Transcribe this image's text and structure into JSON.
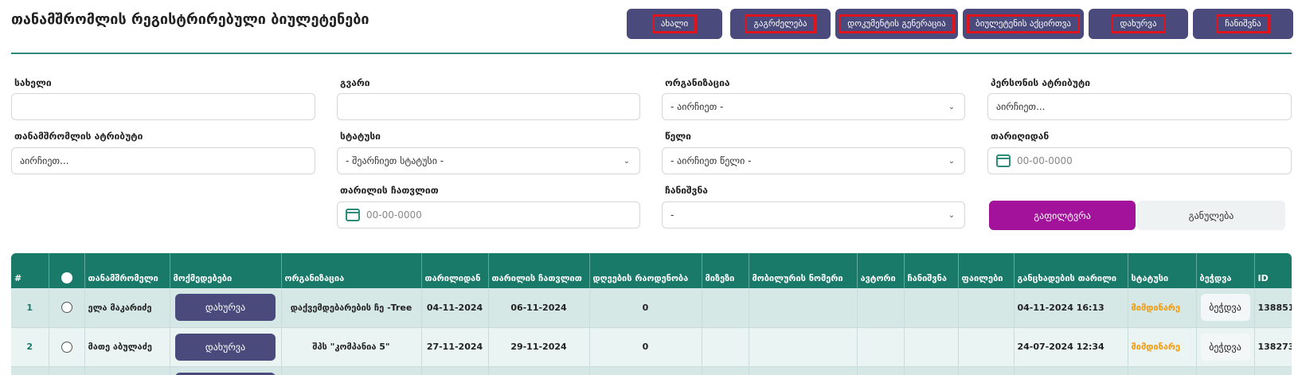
{
  "page": {
    "title": "თანამშრომლის რეგისტრირებული ბიულეტენები"
  },
  "toolbar": {
    "buttons": [
      {
        "label": "ახალი"
      },
      {
        "label": "გაგრძელება"
      },
      {
        "label": "დოკუმენტის გენერაცია"
      },
      {
        "label": "ბიულეტენის აქცირთვა"
      },
      {
        "label": "დახურვა"
      },
      {
        "label": "ჩანიშვნა"
      }
    ]
  },
  "filters": {
    "first_name": {
      "label": "სახელი",
      "value": ""
    },
    "last_name": {
      "label": "გვარი",
      "value": ""
    },
    "organization": {
      "label": "ორგანიზაცია",
      "value": "- აირჩიეთ -"
    },
    "person_attribute": {
      "label": "პერსონის ატრიბუტი",
      "value": "აირჩიეთ..."
    },
    "employee_attribute": {
      "label": "თანამშრომლის ატრიბუტი",
      "value": "აირჩიეთ..."
    },
    "status": {
      "label": "სტატუსი",
      "value": "- შეარჩიეთ სტატუსი -"
    },
    "year": {
      "label": "წელი",
      "value": "- აირჩიეთ წელი -"
    },
    "date_from": {
      "label": "თარიღიდან",
      "placeholder": "00-00-0000"
    },
    "date_to": {
      "label": "თარილის ჩათვლით",
      "placeholder": "00-00-0000"
    },
    "bookmark": {
      "label": "ჩანიშვნა",
      "value": "-"
    },
    "filter_button": "გაფილტვრა",
    "reset_button": "განულება"
  },
  "table": {
    "headers": [
      "#",
      "",
      "თანამშრომელი",
      "მოქმედებები",
      "ორგანიზაცია",
      "თარილიდან",
      "თარილის ჩათვლით",
      "დღეების რაოდენობა",
      "მიზეზი",
      "მობილურის ნომერი",
      "ავტორი",
      "ჩანიშვნა",
      "ფაილები",
      "განცხადების თარილი",
      "სტატუსი",
      "ბეჭდვა",
      "ID"
    ],
    "rows": [
      {
        "num": "1",
        "employee": "ელა მაკარიძე",
        "action": "დახურვა",
        "organization": "დაქვემდებარების ჩე -Tree",
        "date_from": "04-11-2024",
        "date_to": "06-11-2024",
        "days": "0",
        "reason": "",
        "mobile": "",
        "author": "",
        "bookmark": "",
        "files": "",
        "application_date": "04-11-2024 16:13",
        "status": "მიმდინარე",
        "print": "ბეჭდვა",
        "id": "138851"
      },
      {
        "num": "2",
        "employee": "მათე აბულაძე",
        "action": "დახურვა",
        "organization": "შპს \"კომპანია 5\"",
        "date_from": "27-11-2024",
        "date_to": "29-11-2024",
        "days": "0",
        "reason": "",
        "mobile": "",
        "author": "",
        "bookmark": "",
        "files": "",
        "application_date": "24-07-2024 12:34",
        "status": "მიმდინარე",
        "print": "ბეჭდვა",
        "id": "138273"
      }
    ]
  }
}
